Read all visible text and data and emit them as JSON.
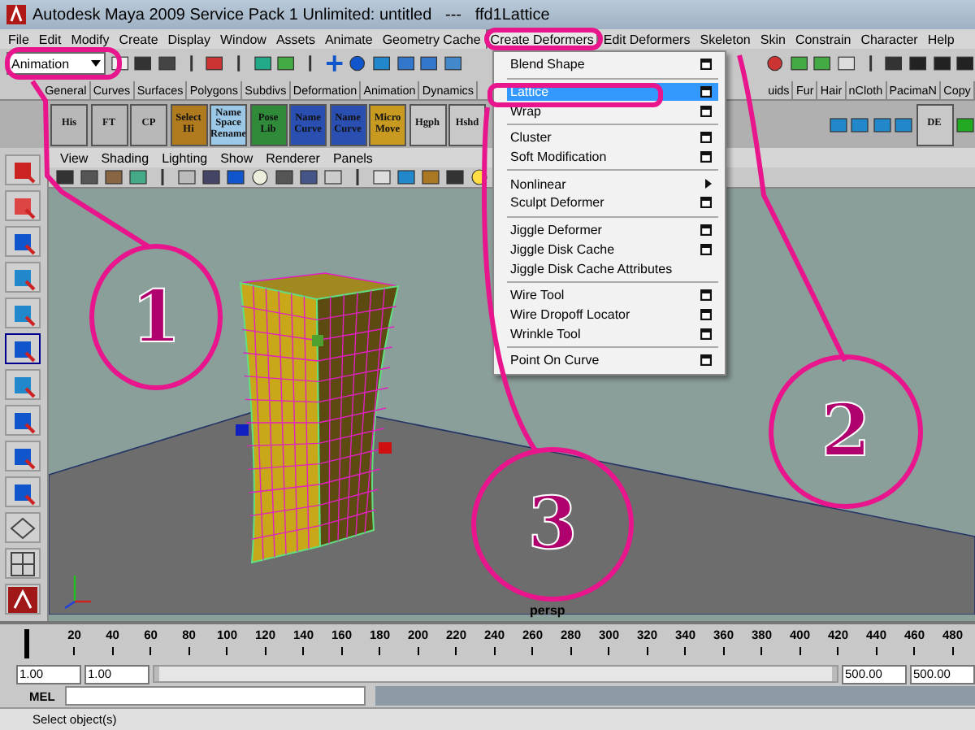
{
  "window": {
    "title": "Autodesk Maya 2009 Service Pack 1 Unlimited: untitled   ---   ffd1Lattice"
  },
  "menu_bar": [
    {
      "label": "File",
      "selected": false
    },
    {
      "label": "Edit",
      "selected": false
    },
    {
      "label": "Modify",
      "selected": false
    },
    {
      "label": "Create",
      "selected": false
    },
    {
      "label": "Display",
      "selected": false
    },
    {
      "label": "Window",
      "selected": false
    },
    {
      "label": "Assets",
      "selected": false
    },
    {
      "label": "Animate",
      "selected": false
    },
    {
      "label": "Geometry Cache",
      "selected": false
    },
    {
      "label": "Create Deformers",
      "selected": true
    },
    {
      "label": "Edit Deformers",
      "selected": false
    },
    {
      "label": "Skeleton",
      "selected": false
    },
    {
      "label": "Skin",
      "selected": false
    },
    {
      "label": "Constrain",
      "selected": false
    },
    {
      "label": "Character",
      "selected": false
    },
    {
      "label": "Help",
      "selected": false
    }
  ],
  "status_line": {
    "mode_dropdown": "Animation"
  },
  "shelf_tabs": {
    "left": [
      "General",
      "Curves",
      "Surfaces",
      "Polygons",
      "Subdivs",
      "Deformation",
      "Animation",
      "Dynamics"
    ],
    "right": [
      "uids",
      "Fur",
      "Hair",
      "nCloth",
      "PacimaN",
      "Copy"
    ]
  },
  "shelf_buttons": [
    {
      "label": "His",
      "color": "#b8b8b8"
    },
    {
      "label": "FT",
      "color": "#b8b8b8"
    },
    {
      "label": "CP",
      "color": "#b8b8b8"
    },
    {
      "label": "Select Hi",
      "color": "#b07a1e"
    },
    {
      "label": "Name Space Rename",
      "color": "#9cc8e8"
    },
    {
      "label": "Pose Lib",
      "color": "#2f8a3a"
    },
    {
      "label": "Name Curve",
      "color": "#2a4fb0"
    },
    {
      "label": "Name Curve",
      "color": "#2a4fb0"
    },
    {
      "label": "Micro Move",
      "color": "#c89a20"
    },
    {
      "label": "Hgph",
      "color": "#c8c8c8"
    },
    {
      "label": "Hshd",
      "color": "#c8c8c8"
    }
  ],
  "shelf_buttons_right": [
    {
      "label": "DE",
      "color": "#c8c8c8"
    }
  ],
  "panel_menu": [
    "View",
    "Shading",
    "Lighting",
    "Show",
    "Renderer",
    "Panels"
  ],
  "viewport": {
    "camera_label": "persp"
  },
  "deformers_menu": {
    "groups": [
      [
        {
          "label": "Blend Shape",
          "kind": "option",
          "selected": false
        }
      ],
      [
        {
          "label": "Lattice",
          "kind": "option",
          "selected": true
        },
        {
          "label": "Wrap",
          "kind": "option",
          "selected": false
        }
      ],
      [
        {
          "label": "Cluster",
          "kind": "option",
          "selected": false
        },
        {
          "label": "Soft Modification",
          "kind": "option",
          "selected": false
        }
      ],
      [
        {
          "label": "Nonlinear",
          "kind": "submenu",
          "selected": false
        },
        {
          "label": "Sculpt Deformer",
          "kind": "option",
          "selected": false
        }
      ],
      [
        {
          "label": "Jiggle Deformer",
          "kind": "option",
          "selected": false
        },
        {
          "label": "Jiggle Disk Cache",
          "kind": "option",
          "selected": false
        },
        {
          "label": "Jiggle Disk Cache Attributes",
          "kind": "plain",
          "selected": false
        }
      ],
      [
        {
          "label": "Wire Tool",
          "kind": "option",
          "selected": false
        },
        {
          "label": "Wire Dropoff Locator",
          "kind": "option",
          "selected": false
        },
        {
          "label": "Wrinkle Tool",
          "kind": "option",
          "selected": false
        }
      ],
      [
        {
          "label": "Point On Curve",
          "kind": "option",
          "selected": false
        }
      ]
    ]
  },
  "time_slider": {
    "level": 0.002,
    "ticks": [
      "20",
      "40",
      "60",
      "80",
      "100",
      "120",
      "140",
      "160",
      "180",
      "200",
      "220",
      "240",
      "260",
      "280",
      "300",
      "320",
      "340",
      "360",
      "380",
      "400",
      "420",
      "440",
      "460",
      "480"
    ]
  },
  "range_slider": {
    "level": 1,
    "start": "1.00",
    "playback_start": "1.00",
    "playback_end": "500.00",
    "end": "500.00"
  },
  "command_line": {
    "label": "MEL"
  },
  "help_line": "Select object(s)",
  "annotations": [
    {
      "label": "1"
    },
    {
      "label": "2"
    },
    {
      "label": "3"
    }
  ]
}
